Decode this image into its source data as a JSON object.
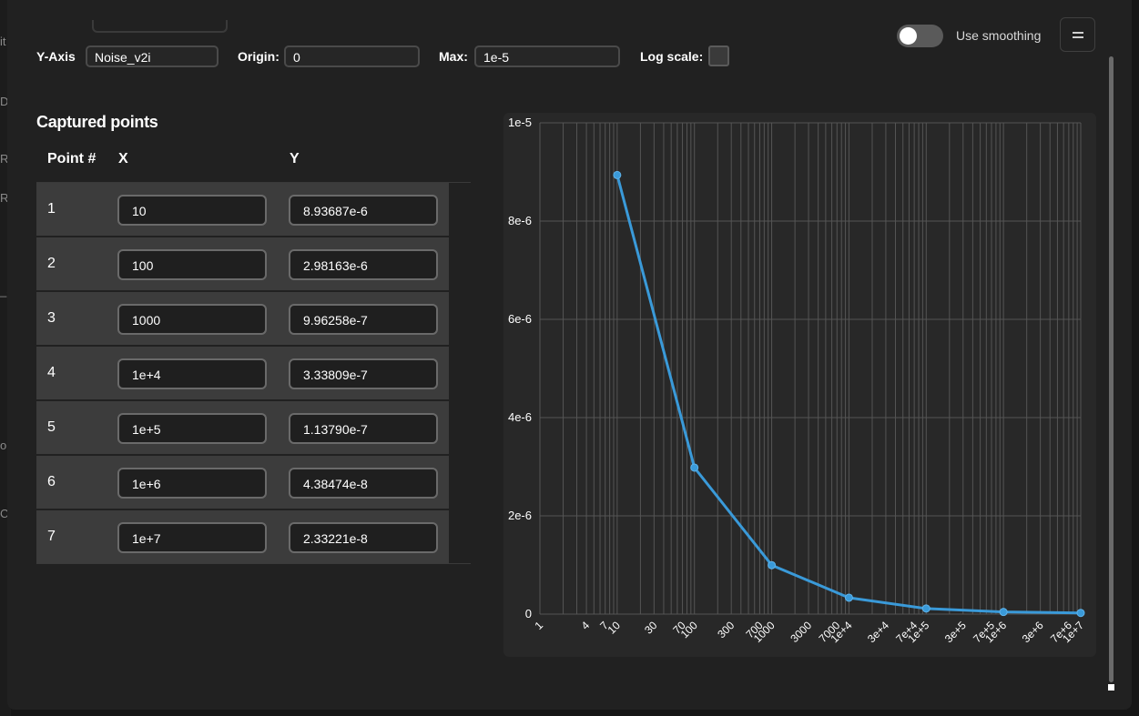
{
  "background_fragments": [
    "it",
    "Do",
    "RI",
    "R",
    "_S",
    "oi",
    "C"
  ],
  "y_axis": {
    "label": "Y-Axis",
    "value": "Noise_v2i"
  },
  "origin": {
    "label": "Origin:",
    "value": "0"
  },
  "max": {
    "label": "Max:",
    "value": "1e-5"
  },
  "log_scale": {
    "label": "Log scale:",
    "checked": false
  },
  "smoothing": {
    "label": "Use smoothing",
    "on": false
  },
  "menu_icon": "hamburger-icon",
  "captured": {
    "title": "Captured points",
    "columns": [
      "Point #",
      "X",
      "Y"
    ],
    "rows": [
      {
        "n": "1",
        "x": "10",
        "y": "8.93687e-6"
      },
      {
        "n": "2",
        "x": "100",
        "y": "2.98163e-6"
      },
      {
        "n": "3",
        "x": "1000",
        "y": "9.96258e-7"
      },
      {
        "n": "4",
        "x": "1e+4",
        "y": "3.33809e-7"
      },
      {
        "n": "5",
        "x": "1e+5",
        "y": "1.13790e-7"
      },
      {
        "n": "6",
        "x": "1e+6",
        "y": "4.38474e-8"
      },
      {
        "n": "7",
        "x": "1e+7",
        "y": "2.33221e-8"
      }
    ]
  },
  "colors": {
    "line": "#3a9ad9",
    "grid": "#555555",
    "panel": "#282828",
    "modal": "#212121"
  },
  "chart_data": {
    "type": "line",
    "x_scale": "log",
    "grid": true,
    "x": [
      10,
      100,
      1000,
      10000,
      100000,
      1000000,
      10000000
    ],
    "y": [
      8.93687e-06,
      2.98163e-06,
      9.96258e-07,
      3.33809e-07,
      1.1379e-07,
      4.38474e-08,
      2.33221e-08
    ],
    "xlim": [
      1,
      10000000
    ],
    "ylim": [
      0,
      1e-05
    ],
    "y_ticks": [
      0,
      2e-06,
      4e-06,
      6e-06,
      8e-06,
      1e-05
    ],
    "y_tick_labels": [
      "0",
      "2e-6",
      "4e-6",
      "6e-6",
      "8e-6",
      "1e-5"
    ],
    "x_ticks": [
      1,
      4,
      7,
      10,
      30,
      70,
      100,
      300,
      700,
      1000,
      3000,
      7000,
      10000,
      30000,
      70000,
      100000,
      300000,
      700000,
      1000000,
      3000000,
      7000000,
      10000000
    ],
    "x_tick_labels": [
      "1",
      "4",
      "7",
      "10",
      "30",
      "70",
      "100",
      "300",
      "700",
      "1000",
      "3000",
      "7000",
      "1e+4",
      "3e+4",
      "7e+4",
      "1e+5",
      "3e+5",
      "7e+5",
      "1e+6",
      "3e+6",
      "7e+6",
      "1e+7"
    ]
  }
}
